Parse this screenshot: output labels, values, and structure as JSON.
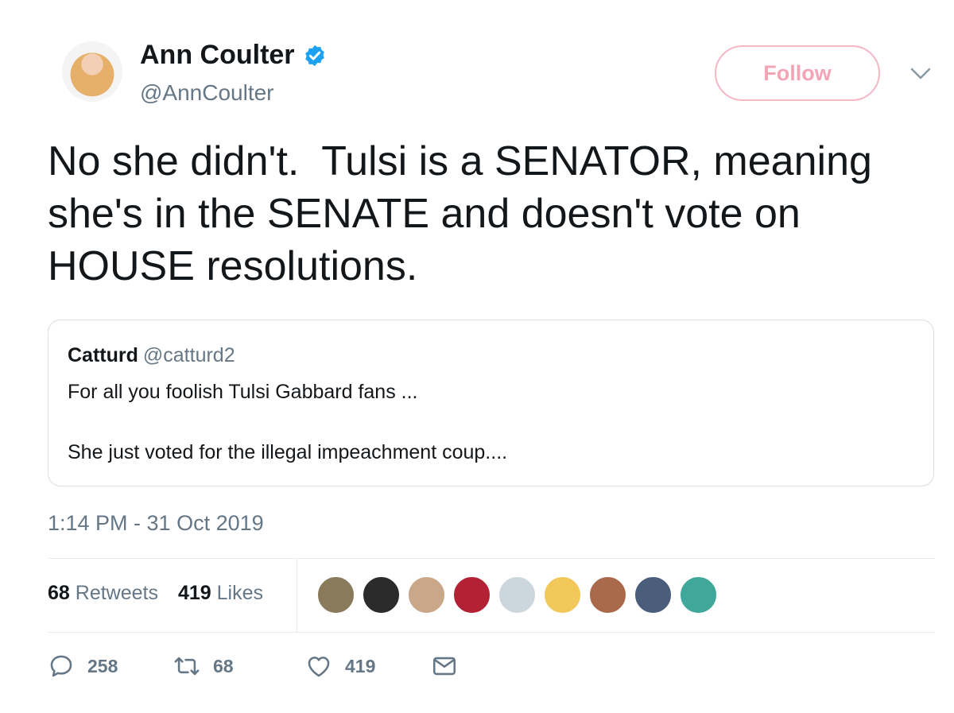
{
  "author": {
    "name": "Ann Coulter",
    "handle": "@AnnCoulter",
    "verified": true,
    "follow_label": "Follow"
  },
  "tweet": {
    "text": "No she didn't.  Tulsi is a SENATOR, meaning she's in the SENATE and doesn't vote on HOUSE resolutions.",
    "timestamp": "1:14 PM - 31 Oct 2019"
  },
  "quoted_tweet": {
    "name": "Catturd",
    "handle": "@catturd2",
    "line1": "For all you foolish Tulsi Gabbard fans ...",
    "line2": "She just voted for the illegal impeachment coup...."
  },
  "stats": {
    "retweets_count": "68",
    "retweets_label": "Retweets",
    "likes_count": "419",
    "likes_label": "Likes"
  },
  "liker_avatars": [
    {
      "color": "#8a7a5c"
    },
    {
      "color": "#2b2b2b"
    },
    {
      "color": "#c9a88a"
    },
    {
      "color": "#b22234"
    },
    {
      "color": "#ccd6dd"
    },
    {
      "color": "#f2c85b"
    },
    {
      "color": "#a86a4a"
    },
    {
      "color": "#4a5d7a"
    },
    {
      "color": "#3fa89a"
    }
  ],
  "actions": {
    "replies": "258",
    "retweets": "68",
    "likes": "419"
  },
  "colors": {
    "verified_blue": "#1da1f2",
    "follow_pink": "#f3a5b6",
    "text_gray": "#657786"
  },
  "icons": [
    "verified-icon",
    "chevron-down-icon",
    "reply-icon",
    "retweet-icon",
    "like-icon",
    "message-icon"
  ]
}
